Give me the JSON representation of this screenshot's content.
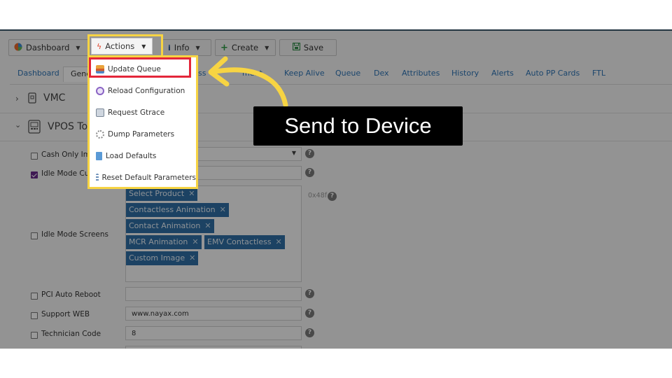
{
  "toolbar": {
    "dashboard": "Dashboard",
    "actions": "Actions",
    "info": "Info",
    "create": "Create",
    "save": "Save"
  },
  "tabs": [
    {
      "label": "Dashboard"
    },
    {
      "label": "Gene"
    },
    {
      "label": "ss"
    },
    {
      "label": "ment"
    },
    {
      "label": "Keep Alive"
    },
    {
      "label": "Queue"
    },
    {
      "label": "Dex"
    },
    {
      "label": "Attributes"
    },
    {
      "label": "History"
    },
    {
      "label": "Alerts"
    },
    {
      "label": "Auto PP Cards"
    },
    {
      "label": "FTL"
    }
  ],
  "sections": {
    "vmc": "VMC",
    "vpos": "VPOS Tou"
  },
  "actions_menu": [
    {
      "label": "Update Queue",
      "icon": "queue-icon"
    },
    {
      "label": "Reload Configuration",
      "icon": "reload-icon"
    },
    {
      "label": "Request Gtrace",
      "icon": "trace-icon"
    },
    {
      "label": "Dump Parameters",
      "icon": "gear-icon"
    },
    {
      "label": "Load Defaults",
      "icon": "load-icon"
    },
    {
      "label": "Reset Default Parameters",
      "icon": "list-icon"
    }
  ],
  "form": {
    "cash_only": {
      "label": "Cash Only Ima",
      "checked": false
    },
    "idle_mode_custom": {
      "label": "Idle Mode Cus",
      "checked": true
    },
    "idle_mode_screens": {
      "label": "Idle Mode Screens",
      "checked": false,
      "hex": "0x48f",
      "chips": [
        "Select Product",
        "Contactless Animation",
        "Contact Animation",
        "MCR Animation",
        "EMV Contactless",
        "Custom Image"
      ]
    },
    "pci_auto_reboot": {
      "label": "PCI Auto Reboot",
      "checked": false,
      "value": ""
    },
    "support_web": {
      "label": "Support WEB",
      "checked": false,
      "value": "www.nayax.com"
    },
    "technician_code": {
      "label": "Technician Code",
      "checked": false,
      "value": "8"
    }
  },
  "callout": {
    "text": "Send to Device"
  },
  "colors": {
    "highlight_frame": "#f7d443",
    "selected_item_border": "#e3263a",
    "tab_link": "#2e74b5",
    "chip_bg": "#2f6fa6",
    "arrow": "#f7d443"
  }
}
